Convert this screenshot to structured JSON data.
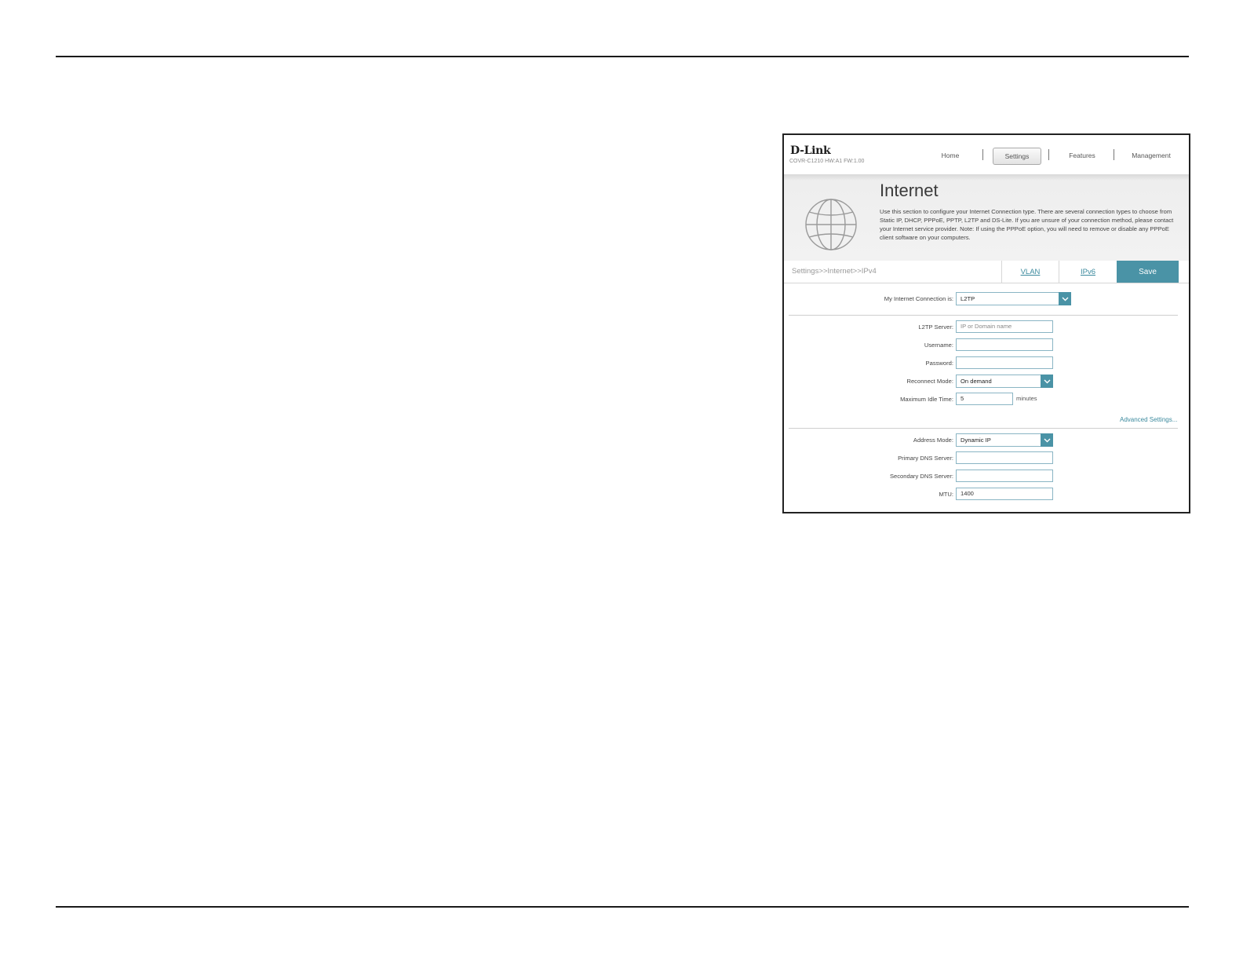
{
  "app": {
    "logo": "D-Link",
    "model_info": "COVR-C1210 HW:A1 FW:1.00",
    "nav": [
      "Home",
      "Settings",
      "Features",
      "Management"
    ],
    "active_nav": "Settings"
  },
  "banner": {
    "title": "Internet",
    "description": "Use this section to configure your Internet Connection type. There are several connection types to choose from Static IP, DHCP, PPPoE, PPTP, L2TP and DS-Lite. If you are unsure of your connection method, please contact your Internet service provider. Note: If using the PPPoE option, you will need to remove or disable any PPPoE client software on your computers."
  },
  "breadcrumb": "Settings>>Internet>>IPv4",
  "tabs": {
    "vlan": "VLAN",
    "ipv6": "IPv6",
    "save": "Save"
  },
  "form": {
    "connection_label": "My Internet Connection is:",
    "connection_value": "L2TP",
    "l2tp_server_label": "L2TP Server:",
    "l2tp_server_placeholder": "IP or Domain name",
    "username_label": "Username:",
    "username_value": "",
    "password_label": "Password:",
    "password_value": "",
    "reconnect_label": "Reconnect Mode:",
    "reconnect_value": "On demand",
    "idle_label": "Maximum Idle Time:",
    "idle_value": "5",
    "idle_unit": "minutes",
    "advanced_link": "Advanced Settings...",
    "address_mode_label": "Address Mode:",
    "address_mode_value": "Dynamic IP",
    "primary_dns_label": "Primary DNS Server:",
    "primary_dns_value": "",
    "secondary_dns_label": "Secondary DNS Server:",
    "secondary_dns_value": "",
    "mtu_label": "MTU:",
    "mtu_value": "1400"
  },
  "colors": {
    "accent": "#4a93a6",
    "link": "#3c8a9e",
    "input_border": "#8ab5c4"
  }
}
